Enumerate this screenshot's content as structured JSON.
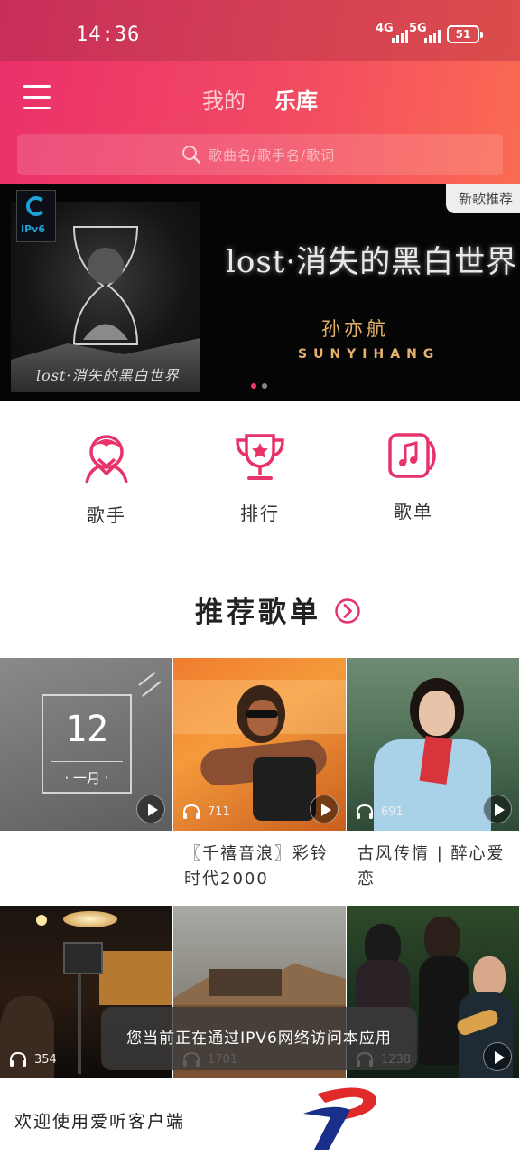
{
  "status_bar": {
    "time": "14:36",
    "net1": "4G",
    "net2": "5G",
    "battery": "51"
  },
  "header": {
    "tab_mine": "我的",
    "tab_library": "乐库",
    "search_placeholder": "歌曲名/歌手名/歌词",
    "colors": {
      "gradient_start": "#ea2f6a",
      "gradient_end": "#fb6b52"
    }
  },
  "banner": {
    "badge": "IPv6",
    "album_small_title": "lost·消失的黑白世界",
    "title": "lost·消失的黑白世界",
    "artist_cn": "孙亦航",
    "artist_en": "SUNYIHANG",
    "tag": "新歌推荐",
    "slides": 2,
    "active_slide": 1
  },
  "quick_nav": [
    {
      "label": "歌手",
      "icon": "singer-icon"
    },
    {
      "label": "排行",
      "icon": "trophy-icon"
    },
    {
      "label": "歌单",
      "icon": "music-note-icon"
    }
  ],
  "section": {
    "title": "推荐歌单"
  },
  "playlists": [
    {
      "title": "",
      "plays": "",
      "calendar_day": "12",
      "calendar_month": "· 一月 ·"
    },
    {
      "title": "〖千禧音浪〗彩铃时代2000",
      "plays": "711"
    },
    {
      "title": "古风传情 | 醉心爱恋",
      "plays": "691"
    },
    {
      "title": "",
      "plays": "354"
    },
    {
      "title": "",
      "plays": "1701"
    },
    {
      "title": "",
      "plays": "1238"
    }
  ],
  "toast": "您当前正在通过IPV6网络访问本应用",
  "footer": {
    "text": "欢迎使用爱听客户端"
  }
}
